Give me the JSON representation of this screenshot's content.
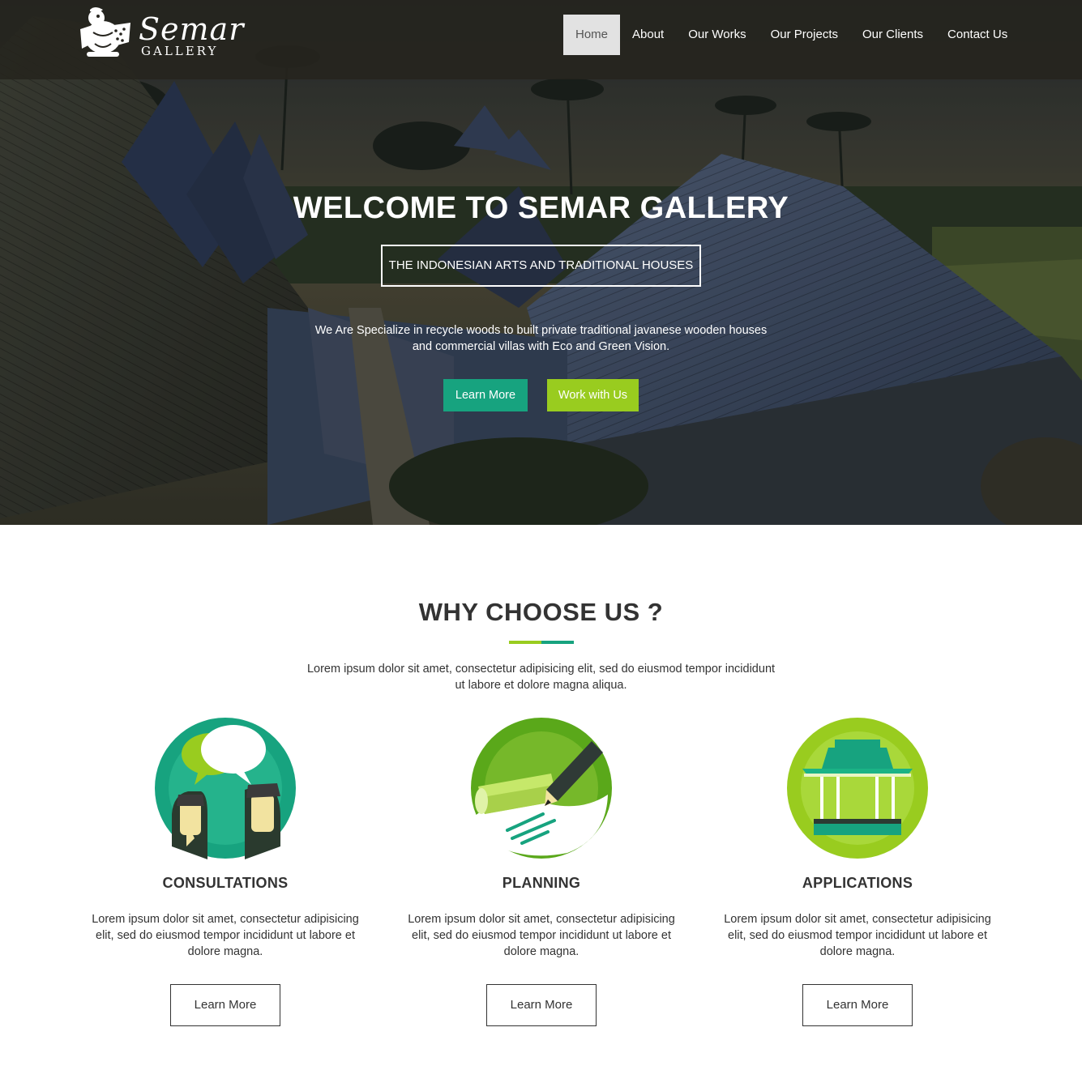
{
  "nav": {
    "logo_title": "Semar",
    "logo_subtitle": "GALLERY",
    "items": [
      "Home",
      "About",
      "Our Works",
      "Our Projects",
      "Our Clients",
      "Contact Us"
    ],
    "active": "Home"
  },
  "hero": {
    "title_prefix": "WELCOME TO",
    "title_bold": "SEMAR GALLERY",
    "tagline": "THE INDONESIAN ARTS AND TRADITIONAL HOUSES",
    "description": "We Are Specialize in recycle woods to built private traditional javanese wooden houses and commercial villas with Eco and Green Vision.",
    "primary_button": "Learn More",
    "secondary_button": "Work with Us"
  },
  "why": {
    "title": "WHY CHOOSE US ?",
    "description": "Lorem ipsum dolor sit amet, consectetur adipisicing elit, sed do eiusmod tempor incididunt ut labore et dolore magna aliqua.",
    "features": [
      {
        "icon": "consultation-icon",
        "title": "CONSULTATIONS",
        "text": "Lorem ipsum dolor sit amet, consectetur adipisicing elit, sed do eiusmod tempor incididunt ut labore et dolore magna.",
        "button": "Learn More"
      },
      {
        "icon": "planning-icon",
        "title": "PLANNING",
        "text": "Lorem ipsum dolor sit amet, consectetur adipisicing elit, sed do eiusmod tempor incididunt ut labore et dolore magna.",
        "button": "Learn More"
      },
      {
        "icon": "pavilion-icon",
        "title": "APPLICATIONS",
        "text": "Lorem ipsum dolor sit amet, consectetur adipisicing elit, sed do eiusmod tempor incididunt ut labore et dolore magna.",
        "button": "Learn More"
      }
    ]
  },
  "colors": {
    "teal": "#17a37f",
    "lime": "#99cc1f",
    "nav_bg": "#26241e"
  }
}
